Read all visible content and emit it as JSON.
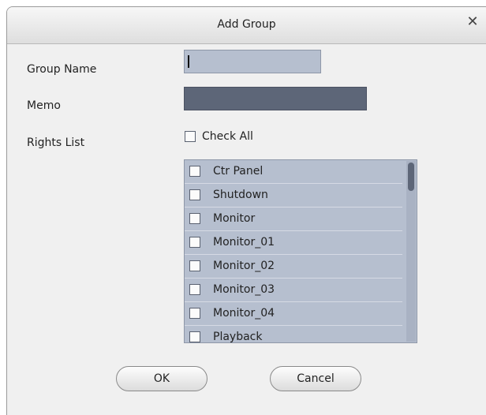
{
  "dialog": {
    "title": "Add Group",
    "close_glyph": "✕"
  },
  "form": {
    "group_name_label": "Group Name",
    "group_name_value": "",
    "memo_label": "Memo",
    "memo_value": "",
    "rights_list_label": "Rights List",
    "check_all_label": "Check All"
  },
  "rights": [
    {
      "label": "Ctr Panel",
      "checked": false
    },
    {
      "label": "Shutdown",
      "checked": false
    },
    {
      "label": "Monitor",
      "checked": false
    },
    {
      "label": "Monitor_01",
      "checked": false
    },
    {
      "label": "Monitor_02",
      "checked": false
    },
    {
      "label": "Monitor_03",
      "checked": false
    },
    {
      "label": "Monitor_04",
      "checked": false
    },
    {
      "label": "Playback",
      "checked": false
    }
  ],
  "buttons": {
    "ok_label": "OK",
    "cancel_label": "Cancel"
  },
  "colors": {
    "field_fill": "#b6bfcf",
    "memo_fill": "#5d6678",
    "scroll_thumb": "#5d6678"
  }
}
